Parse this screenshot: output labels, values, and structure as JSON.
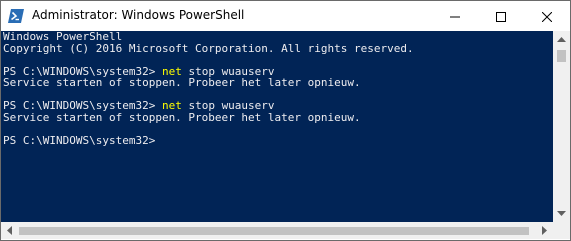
{
  "window": {
    "title": "Administrator: Windows PowerShell",
    "icon": "powershell-icon"
  },
  "caption_buttons": {
    "minimize_icon": "minimize-icon",
    "maximize_icon": "maximize-icon",
    "close_icon": "close-icon"
  },
  "console": {
    "background": "#012456",
    "foreground": "#eeedf0",
    "command_color": "#ffff00",
    "header_line_1": "Windows PowerShell",
    "header_line_2": "Copyright (C) 2016 Microsoft Corporation. All rights reserved.",
    "prompt": "PS C:\\WINDOWS\\system32> ",
    "entries": [
      {
        "command": "net",
        "args": " stop wuauserv",
        "output": "Service starten of stoppen. Probeer het later opnieuw."
      },
      {
        "command": "net",
        "args": " stop wuauserv",
        "output": "Service starten of stoppen. Probeer het later opnieuw."
      }
    ],
    "final_prompt": "PS C:\\WINDOWS\\system32>"
  }
}
